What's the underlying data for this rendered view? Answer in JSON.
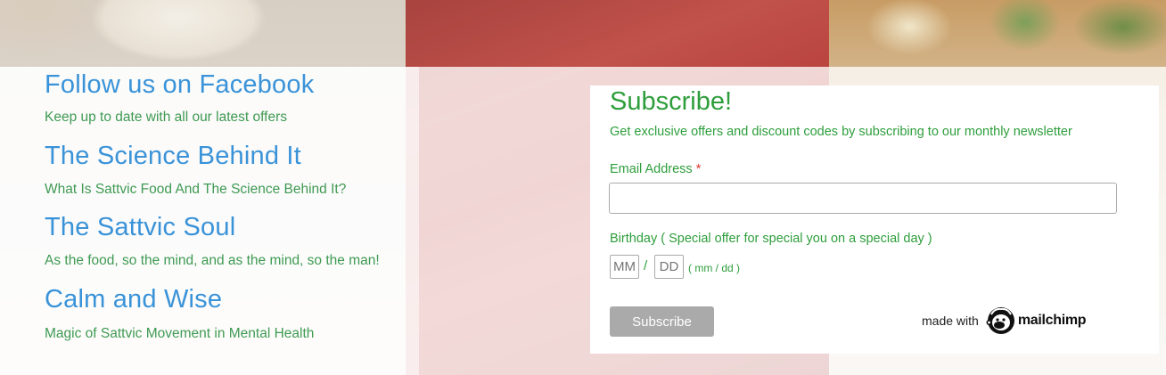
{
  "links": [
    {
      "title": "Follow us on Facebook",
      "subtitle": "Keep up to date with all our latest offers"
    },
    {
      "title": "The Science Behind It",
      "subtitle": "What Is Sattvic Food And The Science Behind It?"
    },
    {
      "title": "The Sattvic Soul",
      "subtitle": "As the food, so the mind, and as the mind, so the man!"
    },
    {
      "title": "Calm and Wise",
      "subtitle": "Magic of Sattvic Movement in Mental Health"
    }
  ],
  "subscribe": {
    "title": "Subscribe!",
    "description": "Get exclusive offers and discount codes by subscribing to our monthly newsletter",
    "email_label": "Email Address",
    "required_mark": "*",
    "email_value": "",
    "birthday_label": "Birthday ( Special offer for special you on a special day )",
    "month_placeholder": "MM",
    "day_placeholder": "DD",
    "date_separator": "/",
    "date_format": "( mm / dd )",
    "button_label": "Subscribe",
    "made_with": "made with",
    "brand": "mailchimp"
  },
  "colors": {
    "heading_blue": "#3a93d8",
    "text_green": "#3f9a53",
    "form_green": "#2e9e3c",
    "required_red": "#d9352e",
    "button_gray": "#aaaaaa"
  }
}
